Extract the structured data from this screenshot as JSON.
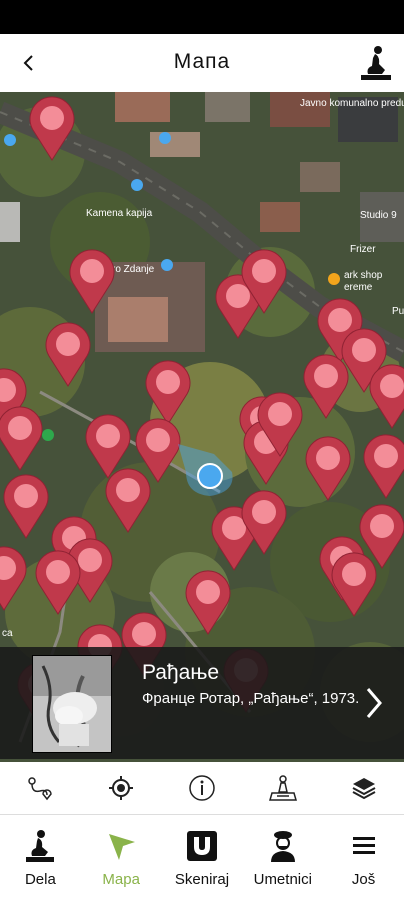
{
  "header": {
    "title": "Мапа"
  },
  "map": {
    "labels": [
      "Javno komunalno preduzeće Bukulja",
      "Kamena kapija",
      "ro Zdanje",
      "Studio 9",
      "Frizer",
      "ark shop",
      "ereme",
      "Pu",
      "ca",
      "ca"
    ],
    "marker_color": "#c0394b",
    "marker_dot_color": "#f38d98",
    "location_color": "#4aa8ef"
  },
  "info_card": {
    "title": "Рађање",
    "subtitle": "Франце Ротар, „Рађање“, 1973."
  },
  "toolbar": {
    "items": [
      "route-icon",
      "locate-icon",
      "info-icon",
      "monument-map-icon",
      "layers-icon"
    ]
  },
  "nav": {
    "items": [
      {
        "label": "Dela",
        "icon": "statue-icon"
      },
      {
        "label": "Mapa",
        "icon": "map-arrow-icon"
      },
      {
        "label": "Skeniraj",
        "icon": "scan-icon"
      },
      {
        "label": "Umetnici",
        "icon": "artist-icon"
      },
      {
        "label": "Još",
        "icon": "menu-icon"
      }
    ]
  },
  "colors": {
    "accent": "#8ab34a"
  }
}
